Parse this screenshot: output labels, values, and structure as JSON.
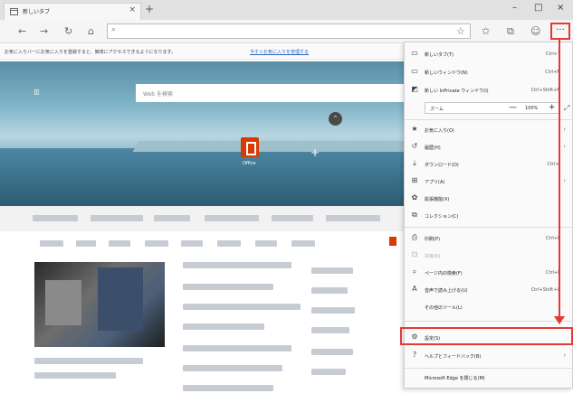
{
  "tab": {
    "title": "新しいタブ",
    "close": "×",
    "new_tab": "+"
  },
  "window": {
    "minimize": "–",
    "maximize": "□",
    "close": "×"
  },
  "nav": {
    "back": "←",
    "forward": "→",
    "refresh": "↻",
    "home": "⌂",
    "address_icon": "⌕",
    "star": "☆",
    "favorites": "✩",
    "collections": "⧉",
    "profile": "☺",
    "more": "···"
  },
  "favbar": {
    "text": "お気に入りバーにお気に入りを登録すると、簡単にアクセスできるようになります。",
    "link": "今すぐお気に入りを管理する"
  },
  "hero": {
    "apps_icon": "⁞⁞⁞",
    "search_placeholder": "Web を検索",
    "collapse_icon": "⌃",
    "office_label": "Office",
    "add_icon": "+"
  },
  "menu": {
    "items": [
      {
        "icon": "▭",
        "label": "新しいタブ(T)",
        "shortcut": "Ctrl+T"
      },
      {
        "icon": "▭",
        "label": "新しいウィンドウ(N)",
        "shortcut": "Ctrl+N"
      },
      {
        "icon": "◩",
        "label": "新しい InPrivate ウィンドウ(I)",
        "shortcut": "Ctrl+Shift+N"
      },
      {
        "icon": "★",
        "label": "お気に入り(O)",
        "shortcut": ""
      },
      {
        "icon": "↺",
        "label": "履歴(H)",
        "shortcut": ""
      },
      {
        "icon": "⤓",
        "label": "ダウンロード(D)",
        "shortcut": "Ctrl+J"
      },
      {
        "icon": "⊞",
        "label": "アプリ(A)",
        "shortcut": ""
      },
      {
        "icon": "✿",
        "label": "拡張機能(X)",
        "shortcut": ""
      },
      {
        "icon": "⧉",
        "label": "コレクション(C)",
        "shortcut": ""
      },
      {
        "icon": "⎙",
        "label": "印刷(P)",
        "shortcut": "Ctrl+P"
      },
      {
        "icon": "⊡",
        "label": "共有(R)",
        "shortcut": ""
      },
      {
        "icon": "⌕",
        "label": "ページ内の検索(F)",
        "shortcut": "Ctrl+F"
      },
      {
        "icon": "A",
        "label": "音声で読み上げる(U)",
        "shortcut": "Ctrl+Shift+U"
      },
      {
        "icon": "",
        "label": "その他のツール(L)",
        "shortcut": ""
      },
      {
        "icon": "⚙",
        "label": "設定(S)",
        "shortcut": ""
      },
      {
        "icon": "?",
        "label": "ヘルプとフィードバック(B)",
        "shortcut": ""
      },
      {
        "icon": "",
        "label": "Microsoft Edge を閉じる(M)",
        "shortcut": ""
      }
    ],
    "zoom": {
      "label": "ズーム",
      "minus": "—",
      "value": "100%",
      "plus": "+",
      "expand": "⤢"
    },
    "chevron": "›"
  }
}
